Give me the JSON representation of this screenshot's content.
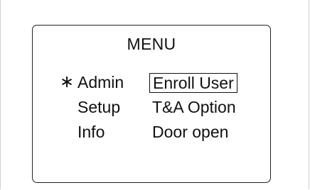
{
  "menu": {
    "title": "MENU",
    "cursor_icon": "asterisk-selector-icon",
    "cursor_glyph": "∗",
    "left_items": [
      {
        "label": "Admin",
        "active": true
      },
      {
        "label": "Setup",
        "active": false
      },
      {
        "label": "Info",
        "active": false
      }
    ],
    "right_items": [
      {
        "label": "Enroll User",
        "selected": true
      },
      {
        "label": "T&A Option",
        "selected": false
      },
      {
        "label": "Door open",
        "selected": false
      }
    ]
  },
  "colors": {
    "text": "#111111",
    "border": "#222222",
    "background": "#ffffff"
  }
}
